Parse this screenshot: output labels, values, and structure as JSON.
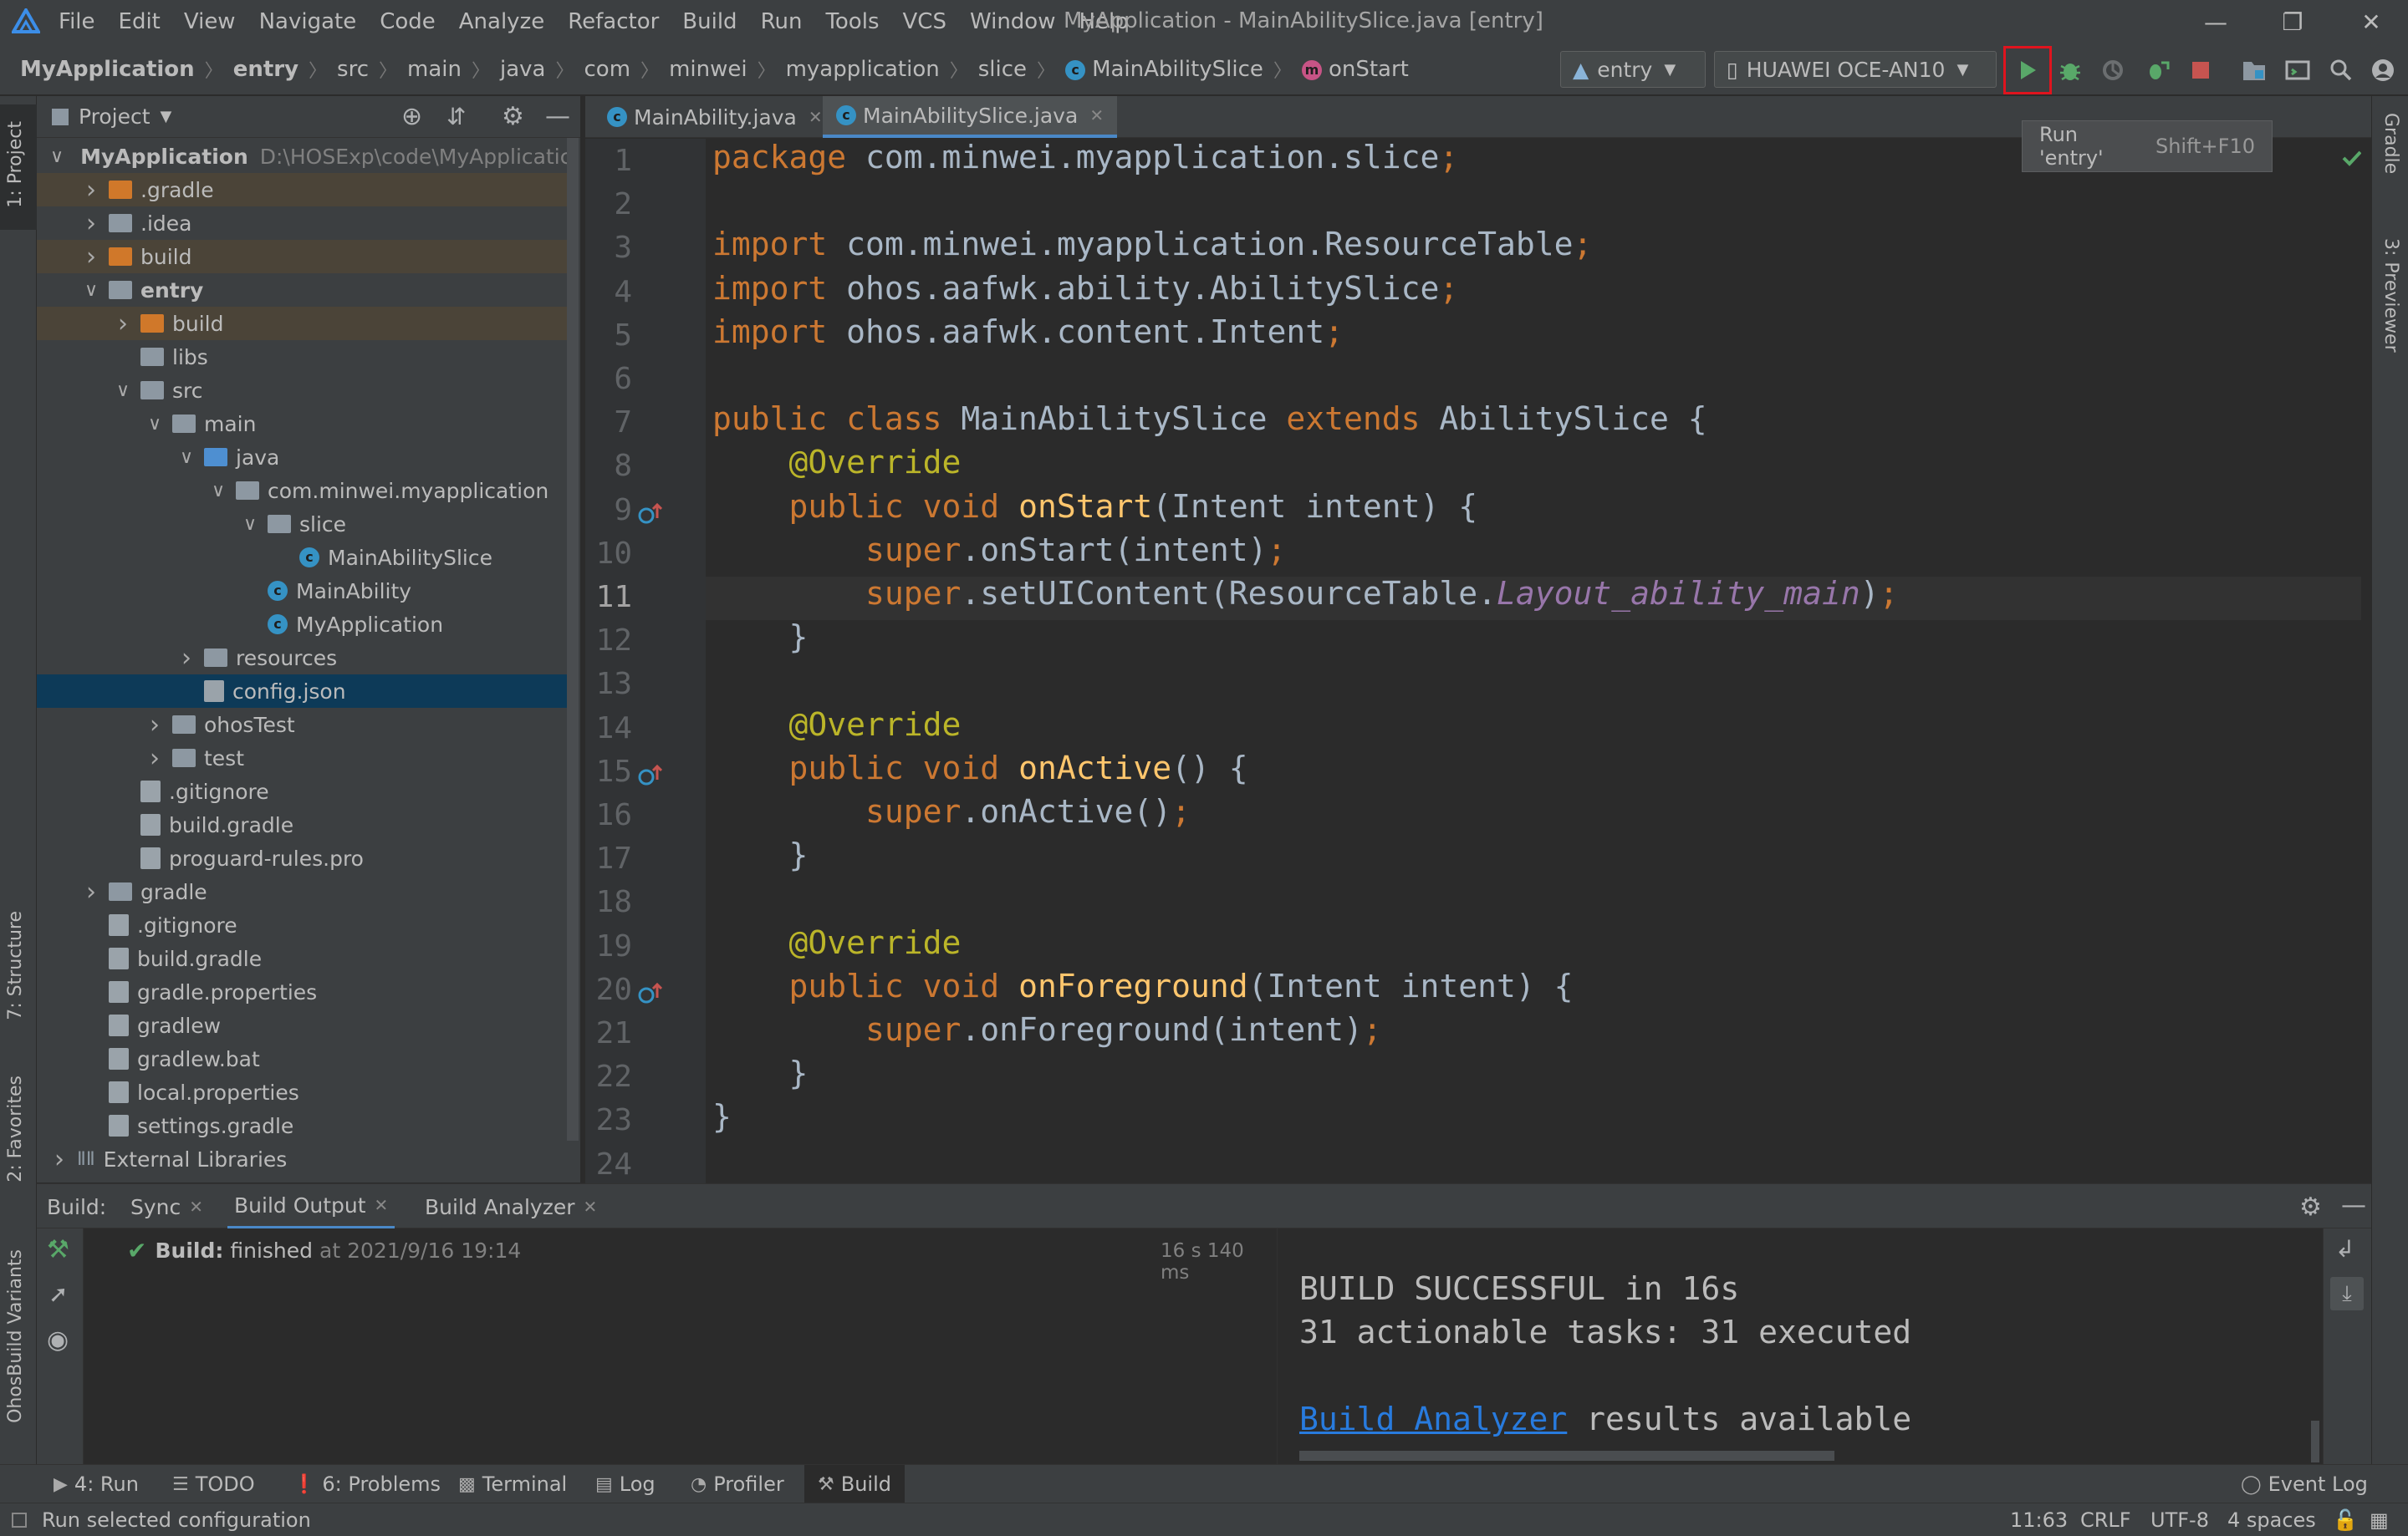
{
  "menubar": {
    "items": [
      "File",
      "Edit",
      "View",
      "Navigate",
      "Code",
      "Analyze",
      "Refactor",
      "Build",
      "Run",
      "Tools",
      "VCS",
      "Window",
      "Help"
    ],
    "window_title": "MyApplication - MainAbilitySlice.java [entry]"
  },
  "breadcrumb": [
    "MyApplication",
    "entry",
    "src",
    "main",
    "java",
    "com",
    "minwei",
    "myapplication",
    "slice",
    "MainAbilitySlice",
    "onStart"
  ],
  "toolbar": {
    "config": "entry",
    "device": "HUAWEI OCE-AN10"
  },
  "tooltip": {
    "text": "Run 'entry'",
    "shortcut": "Shift+F10"
  },
  "left_strip": {
    "project": "1: Project",
    "structure": "7: Structure",
    "favorites": "2: Favorites",
    "build_variants": "OhosBuild Variants"
  },
  "right_strip": {
    "gradle": "Gradle",
    "previewer": "3: Previewer"
  },
  "project_panel": {
    "title": "Project",
    "tree": [
      {
        "label": "MyApplication",
        "path": "D:\\HOSExp\\code\\MyApplicatic",
        "depth": 0,
        "chev": "v",
        "icon": "folder-gray",
        "bold": true
      },
      {
        "label": ".gradle",
        "depth": 1,
        "chev": ">",
        "icon": "folder-orange",
        "hl": true
      },
      {
        "label": ".idea",
        "depth": 1,
        "chev": ">",
        "icon": "folder-gray"
      },
      {
        "label": "build",
        "depth": 1,
        "chev": ">",
        "icon": "folder-orange",
        "hl": true
      },
      {
        "label": "entry",
        "depth": 1,
        "chev": "v",
        "icon": "folder-gray",
        "bold": true
      },
      {
        "label": "build",
        "depth": 2,
        "chev": ">",
        "icon": "folder-orange",
        "hl": true
      },
      {
        "label": "libs",
        "depth": 2,
        "chev": "",
        "icon": "folder-gray"
      },
      {
        "label": "src",
        "depth": 2,
        "chev": "v",
        "icon": "folder-gray"
      },
      {
        "label": "main",
        "depth": 3,
        "chev": "v",
        "icon": "folder-gray"
      },
      {
        "label": "java",
        "depth": 4,
        "chev": "v",
        "icon": "folder-blue"
      },
      {
        "label": "com.minwei.myapplication",
        "depth": 5,
        "chev": "v",
        "icon": "folder-gray"
      },
      {
        "label": "slice",
        "depth": 6,
        "chev": "v",
        "icon": "folder-gray"
      },
      {
        "label": "MainAbilitySlice",
        "depth": 7,
        "chev": "",
        "icon": "class"
      },
      {
        "label": "MainAbility",
        "depth": 6,
        "chev": "",
        "icon": "class"
      },
      {
        "label": "MyApplication",
        "depth": 6,
        "chev": "",
        "icon": "class"
      },
      {
        "label": "resources",
        "depth": 4,
        "chev": ">",
        "icon": "folder-gray"
      },
      {
        "label": "config.json",
        "depth": 4,
        "chev": "",
        "icon": "file",
        "sel": true
      },
      {
        "label": "ohosTest",
        "depth": 3,
        "chev": ">",
        "icon": "folder-gray"
      },
      {
        "label": "test",
        "depth": 3,
        "chev": ">",
        "icon": "folder-gray"
      },
      {
        "label": ".gitignore",
        "depth": 2,
        "chev": "",
        "icon": "file"
      },
      {
        "label": "build.gradle",
        "depth": 2,
        "chev": "",
        "icon": "file"
      },
      {
        "label": "proguard-rules.pro",
        "depth": 2,
        "chev": "",
        "icon": "file"
      },
      {
        "label": "gradle",
        "depth": 1,
        "chev": ">",
        "icon": "folder-gray"
      },
      {
        "label": ".gitignore",
        "depth": 1,
        "chev": "",
        "icon": "file"
      },
      {
        "label": "build.gradle",
        "depth": 1,
        "chev": "",
        "icon": "file"
      },
      {
        "label": "gradle.properties",
        "depth": 1,
        "chev": "",
        "icon": "file"
      },
      {
        "label": "gradlew",
        "depth": 1,
        "chev": "",
        "icon": "file"
      },
      {
        "label": "gradlew.bat",
        "depth": 1,
        "chev": "",
        "icon": "file"
      },
      {
        "label": "local.properties",
        "depth": 1,
        "chev": "",
        "icon": "file"
      },
      {
        "label": "settings.gradle",
        "depth": 1,
        "chev": "",
        "icon": "file"
      },
      {
        "label": "External Libraries",
        "depth": 0,
        "chev": ">",
        "icon": "libs"
      }
    ]
  },
  "editor": {
    "tabs": [
      {
        "label": "MainAbility.java",
        "active": false
      },
      {
        "label": "MainAbilitySlice.java",
        "active": true
      }
    ],
    "current_line": 11,
    "override_lines": [
      9,
      15,
      20
    ],
    "lines": [
      [
        [
          "kw",
          "package "
        ],
        [
          "t",
          "com.minwei.myapplication.slice"
        ],
        [
          "kw",
          ";"
        ]
      ],
      [],
      [
        [
          "kw",
          "import "
        ],
        [
          "t",
          "com.minwei.myapplication.ResourceTable"
        ],
        [
          "kw",
          ";"
        ]
      ],
      [
        [
          "kw",
          "import "
        ],
        [
          "t",
          "ohos.aafwk.ability.AbilitySlice"
        ],
        [
          "kw",
          ";"
        ]
      ],
      [
        [
          "kw",
          "import "
        ],
        [
          "t",
          "ohos.aafwk.content.Intent"
        ],
        [
          "kw",
          ";"
        ]
      ],
      [],
      [
        [
          "kw",
          "public class "
        ],
        [
          "t",
          "MainAbilitySlice "
        ],
        [
          "kw",
          "extends "
        ],
        [
          "t",
          "AbilitySlice {"
        ]
      ],
      [
        [
          "t",
          "    "
        ],
        [
          "an",
          "@Override"
        ]
      ],
      [
        [
          "t",
          "    "
        ],
        [
          "kw",
          "public void "
        ],
        [
          "fn",
          "onStart"
        ],
        [
          "t",
          "(Intent intent) {"
        ]
      ],
      [
        [
          "t",
          "        "
        ],
        [
          "kw",
          "super"
        ],
        [
          "t",
          ".onStart(intent)"
        ],
        [
          "kw",
          ";"
        ]
      ],
      [
        [
          "t",
          "        "
        ],
        [
          "kw",
          "super"
        ],
        [
          "t",
          ".setUIContent(ResourceTable."
        ],
        [
          "it",
          "Layout_ability_main"
        ],
        [
          "t",
          ")"
        ],
        [
          "kw",
          ";"
        ]
      ],
      [
        [
          "t",
          "    }"
        ]
      ],
      [],
      [
        [
          "t",
          "    "
        ],
        [
          "an",
          "@Override"
        ]
      ],
      [
        [
          "t",
          "    "
        ],
        [
          "kw",
          "public void "
        ],
        [
          "fn",
          "onActive"
        ],
        [
          "t",
          "() {"
        ]
      ],
      [
        [
          "t",
          "        "
        ],
        [
          "kw",
          "super"
        ],
        [
          "t",
          ".onActive()"
        ],
        [
          "kw",
          ";"
        ]
      ],
      [
        [
          "t",
          "    }"
        ]
      ],
      [],
      [
        [
          "t",
          "    "
        ],
        [
          "an",
          "@Override"
        ]
      ],
      [
        [
          "t",
          "    "
        ],
        [
          "kw",
          "public void "
        ],
        [
          "fn",
          "onForeground"
        ],
        [
          "t",
          "(Intent intent) {"
        ]
      ],
      [
        [
          "t",
          "        "
        ],
        [
          "kw",
          "super"
        ],
        [
          "t",
          ".onForeground(intent)"
        ],
        [
          "kw",
          ";"
        ]
      ],
      [
        [
          "t",
          "    }"
        ]
      ],
      [
        [
          "t",
          "}"
        ]
      ],
      []
    ]
  },
  "build_panel": {
    "label": "Build:",
    "tabs": [
      {
        "label": "Sync",
        "active": false,
        "closable": true
      },
      {
        "label": "Build Output",
        "active": true,
        "closable": true
      },
      {
        "label": "Build Analyzer",
        "active": false,
        "closable": true
      }
    ],
    "result_bold": "Build:",
    "result_text": "finished",
    "result_time": "at 2021/9/16 19:14",
    "duration": "16 s 140 ms",
    "console": {
      "line1": "BUILD SUCCESSFUL in 16s",
      "line2": "31 actionable tasks: 31 executed",
      "link": "Build Analyzer",
      "line4_rest": " results available"
    }
  },
  "bottom_bar": {
    "run": "4: Run",
    "todo": "TODO",
    "problems": "6: Problems",
    "terminal": "Terminal",
    "log": "Log",
    "profiler": "Profiler",
    "build": "Build",
    "event_log": "Event Log"
  },
  "status_bar": {
    "message": "Run selected configuration",
    "position": "11:63",
    "line_sep": "CRLF",
    "encoding": "UTF-8",
    "indent": "4 spaces"
  }
}
